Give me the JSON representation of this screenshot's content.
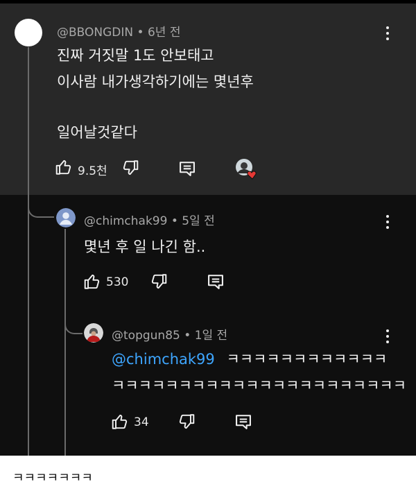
{
  "top_comment": {
    "author": "@BBONGDIN",
    "age": "6년 전",
    "lines": [
      "진짜 거짓말 1도 안보태고",
      "이사람 내가생각하기에는 몇년후",
      "",
      "일어날것같다"
    ],
    "like_count": "9.5천"
  },
  "reply_1": {
    "author": "@chimchak99",
    "age": "5일 전",
    "text": "몇년 후 일 나긴 함..",
    "like_count": "530"
  },
  "reply_2": {
    "author": "@topgun85",
    "age": "1일 전",
    "mention": "@chimchak99",
    "line1": "ㅋㅋㅋㅋㅋㅋㅋㅋㅋㅋㅋㅋ",
    "line2": "ㅋㅋㅋㅋㅋㅋㅋㅋㅋㅋㅋㅋㅋㅋㅋㅋㅋㅋㅋㅋㅋㅋ",
    "like_count": "34"
  },
  "caption": "ㅋㅋㅋㅋㅋㅋㅋ",
  "meta_separator": "•",
  "colors": {
    "page_bg": "#0f0f0f",
    "top_comment_bg": "#282828",
    "mention": "#3ea6ff",
    "heart": "#e53935"
  }
}
